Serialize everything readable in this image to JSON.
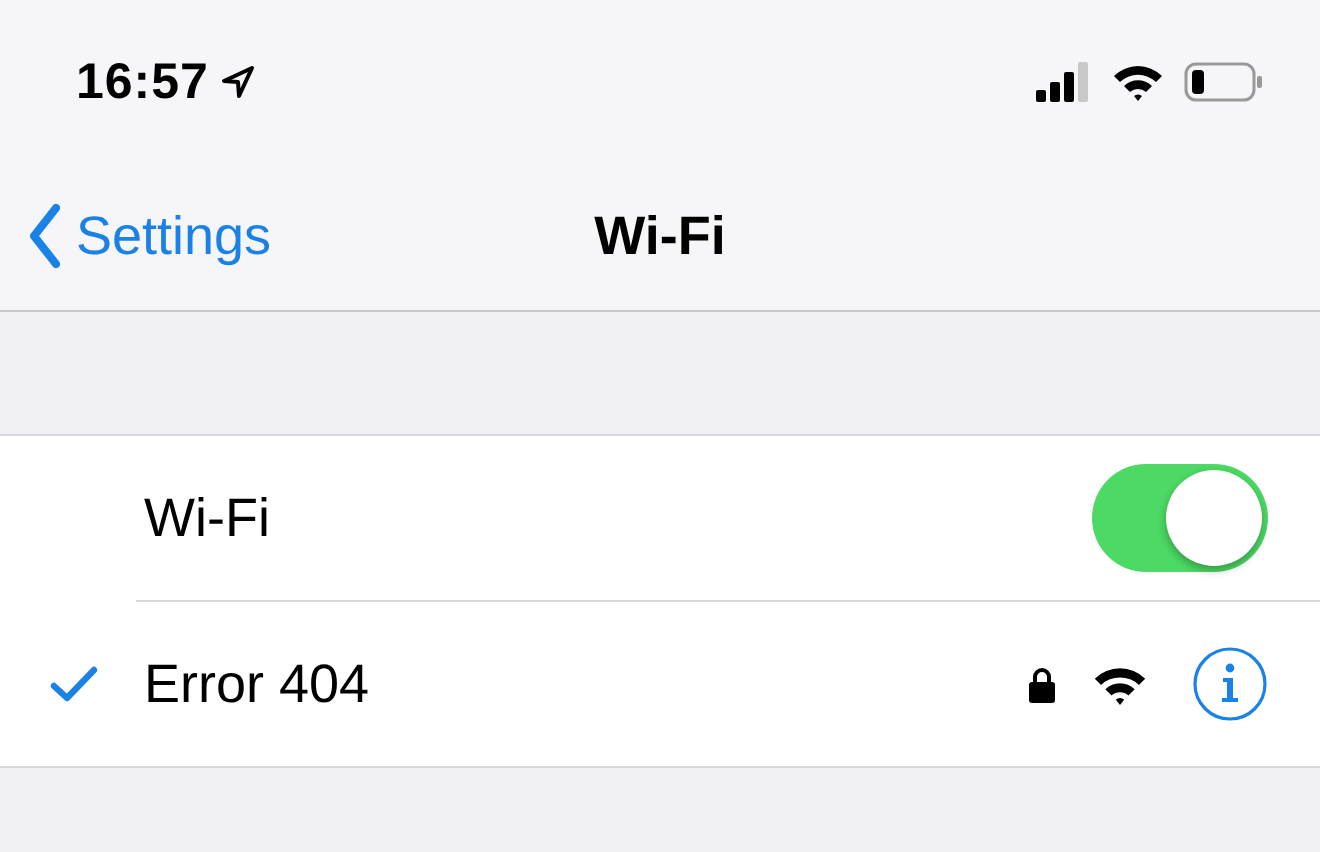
{
  "status_bar": {
    "time": "16:57"
  },
  "nav": {
    "back": "Settings",
    "title": "Wi-Fi"
  },
  "wifi_toggle": {
    "label": "Wi-Fi",
    "on": true
  },
  "networks": [
    {
      "name": "Error 404",
      "selected": true,
      "locked": true
    }
  ]
}
